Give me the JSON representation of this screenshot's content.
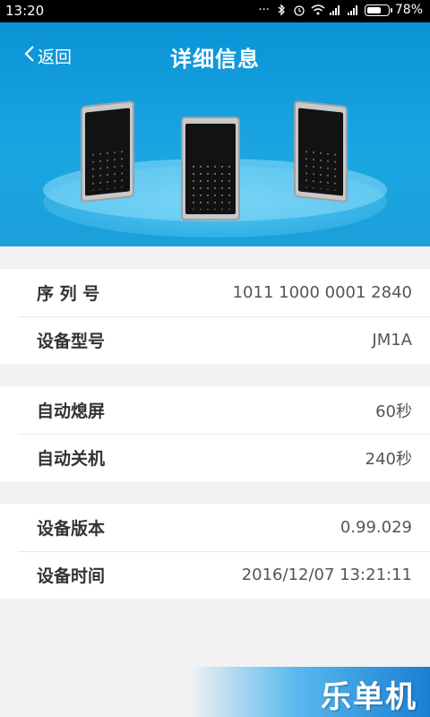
{
  "status_bar": {
    "time": "13:20",
    "dots": "···",
    "battery_pct": "78%",
    "battery_level": 0.78
  },
  "header": {
    "back_label": "返回",
    "title": "详细信息"
  },
  "groups": [
    {
      "rows": [
        {
          "label": "序 列 号",
          "value": "1011  1000  0001  2840"
        },
        {
          "label": "设备型号",
          "value": "JM1A"
        }
      ]
    },
    {
      "rows": [
        {
          "label": "自动熄屏",
          "value": "60秒"
        },
        {
          "label": "自动关机",
          "value": "240秒"
        }
      ]
    },
    {
      "rows": [
        {
          "label": "设备版本",
          "value": "0.99.029"
        },
        {
          "label": "设备时间",
          "value": "2016/12/07  13:21:11"
        }
      ]
    }
  ],
  "watermark": "乐单机",
  "colors": {
    "header_blue": "#1ba6e2",
    "status_black": "#000000",
    "background": "#f2f2f2"
  }
}
